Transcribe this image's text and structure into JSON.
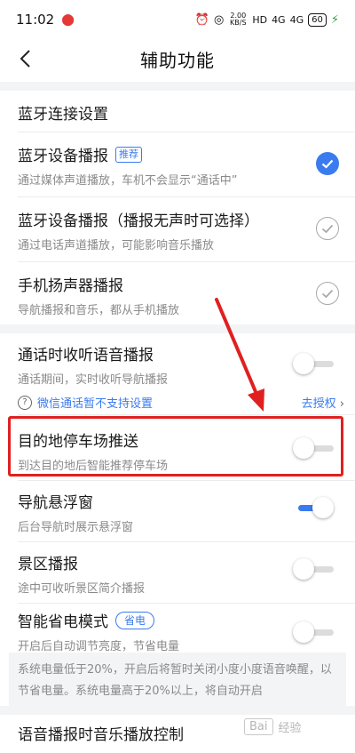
{
  "status": {
    "time": "11:02",
    "net_speed": "2.00 KB/S",
    "hd": "HD",
    "signal1": "4G",
    "signal2": "4G",
    "battery": "60"
  },
  "header": {
    "title": "辅助功能"
  },
  "bt_settings": {
    "label": "蓝牙连接设置"
  },
  "options": [
    {
      "title": "蓝牙设备播报",
      "tag": "推荐",
      "sub": "通过媒体声道播放，车机不会显示“通话中”",
      "checked": true
    },
    {
      "title": "蓝牙设备播报（播报无声时可选择）",
      "sub": "通过电话声道播放，可能影响音乐播放",
      "checked": false
    },
    {
      "title": "手机扬声器播报",
      "sub": "导航播报和音乐，都从手机播放",
      "checked": false
    }
  ],
  "call_broadcast": {
    "title": "通话时收听语音播报",
    "sub": "通话期间，实时收听导航播报",
    "on": false,
    "info": "微信通话暂不支持设置",
    "link": "去授权"
  },
  "parking_push": {
    "title": "目的地停车场推送",
    "sub": "到达目的地后智能推荐停车场",
    "on": false
  },
  "float_window": {
    "title": "导航悬浮窗",
    "sub": "后台导航时展示悬浮窗",
    "on": true
  },
  "scenic": {
    "title": "景区播报",
    "sub": "途中可收听景区简介播报",
    "on": false
  },
  "power_save": {
    "title": "智能省电模式",
    "tag": "省电",
    "sub": "开启后自动调节亮度，节省电量",
    "on": false,
    "note": "系统电量低于20%，开启后将暂时关闭小度小度语音唤醒，以节省电量。系统电量高于20%以上，将自动开启"
  },
  "music_control": {
    "title": "语音播报时音乐播放控制"
  },
  "watermark": {
    "box": "Bai",
    "text": "经验"
  },
  "colors": {
    "accent": "#3a7bf0",
    "annotation": "#e02020"
  }
}
